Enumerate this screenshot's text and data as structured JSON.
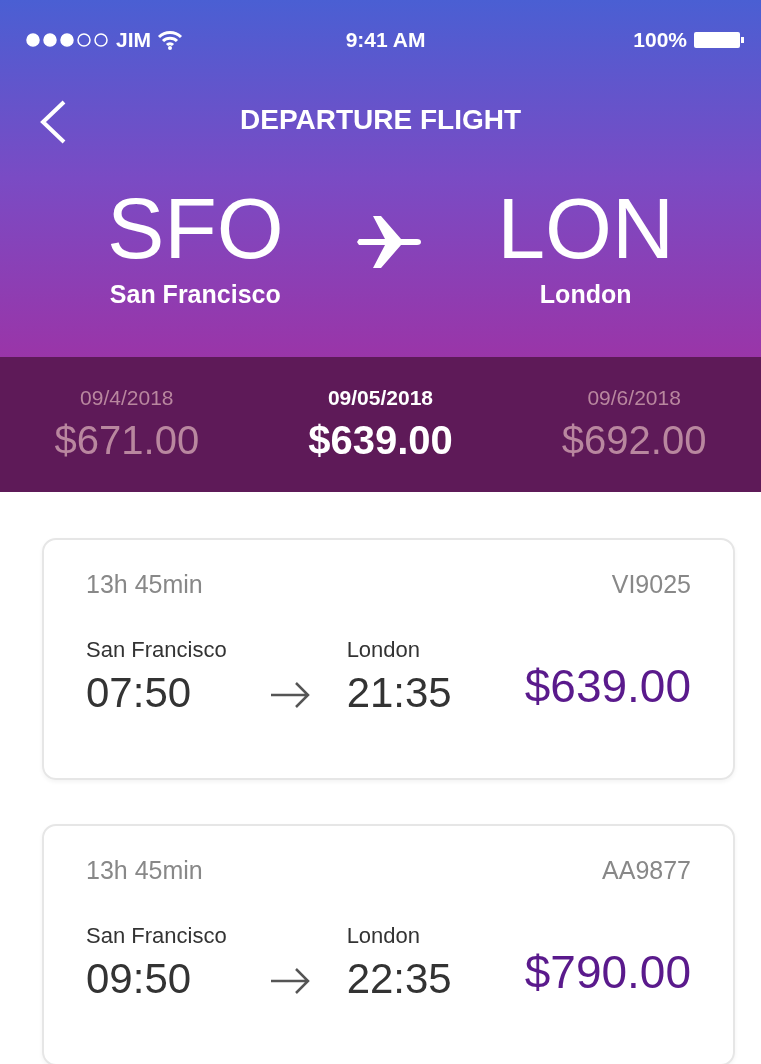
{
  "status_bar": {
    "carrier": "JIM",
    "time": "9:41 AM",
    "battery": "100%"
  },
  "header": {
    "title": "DEPARTURE FLIGHT",
    "origin": {
      "code": "SFO",
      "city": "San Francisco"
    },
    "destination": {
      "code": "LON",
      "city": "London"
    }
  },
  "dates": [
    {
      "date": "09/4/2018",
      "price": "$671.00",
      "selected": false
    },
    {
      "date": "09/05/2018",
      "price": "$639.00",
      "selected": true
    },
    {
      "date": "09/6/2018",
      "price": "$692.00",
      "selected": false
    }
  ],
  "flights": [
    {
      "duration": "13h 45min",
      "flight_number": "VI9025",
      "from_city": "San Francisco",
      "depart": "07:50",
      "to_city": "London",
      "arrive": "21:35",
      "price": "$639.00"
    },
    {
      "duration": "13h 45min",
      "flight_number": "AA9877",
      "from_city": "San Francisco",
      "depart": "09:50",
      "to_city": "London",
      "arrive": "22:35",
      "price": "$790.00"
    }
  ]
}
